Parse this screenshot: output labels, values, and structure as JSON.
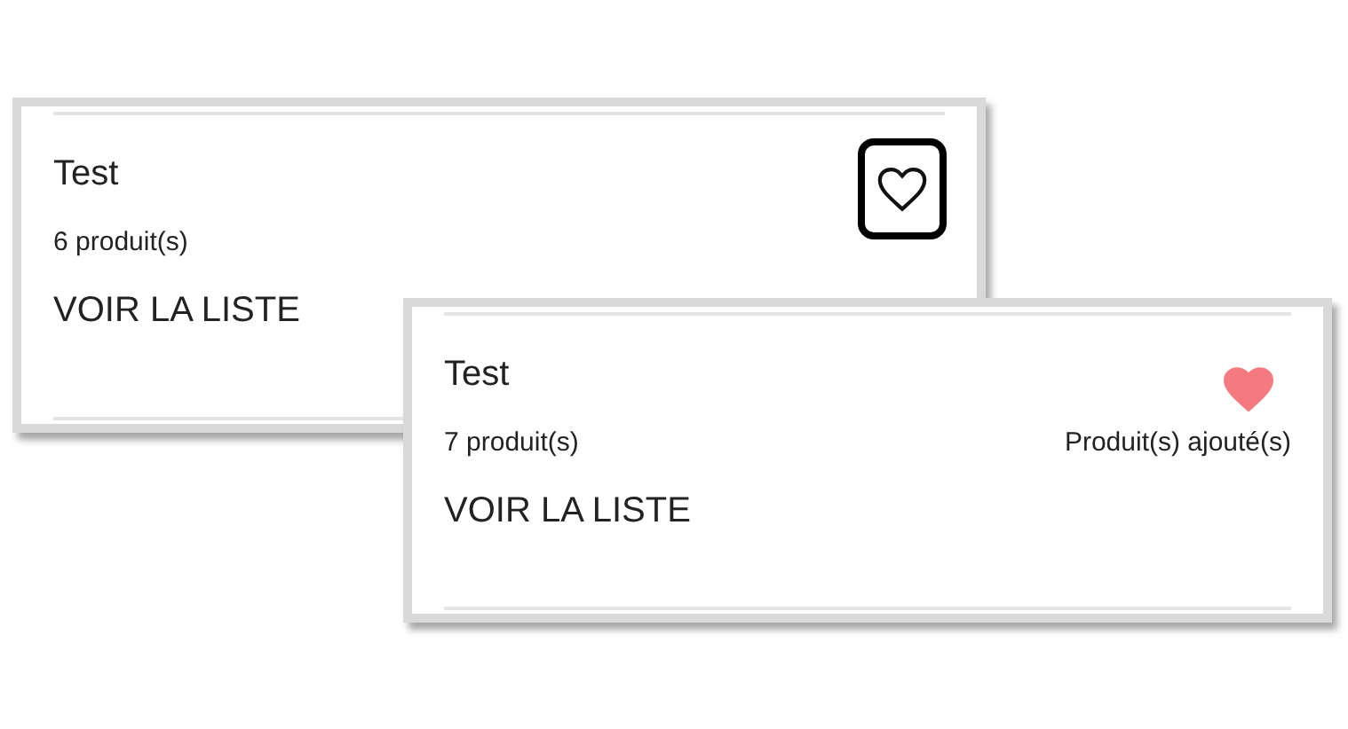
{
  "cards": [
    {
      "title": "Test",
      "count": "6 produit(s)",
      "link": "VOIR LA LISTE",
      "favorite": false,
      "focused": true
    },
    {
      "title": "Test",
      "count": "7 produit(s)",
      "link": "VOIR LA LISTE",
      "favorite": true,
      "focused": false,
      "note": "Produit(s) ajouté(s)"
    }
  ]
}
